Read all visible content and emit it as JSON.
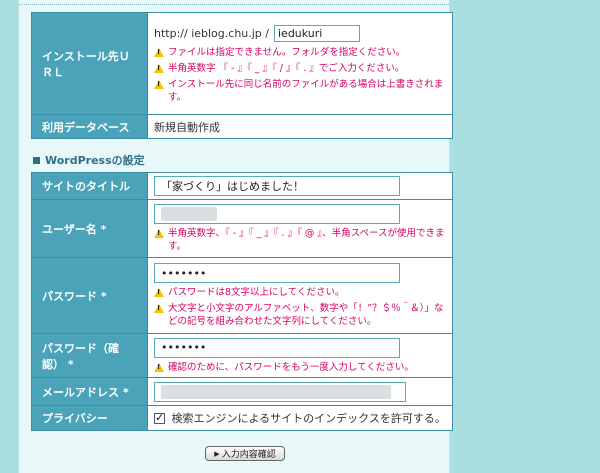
{
  "install": {
    "label": "インストール先ＵＲＬ",
    "url_prefix": "http:// ieblog.chu.jp /",
    "dir_value": "iedukuri",
    "warnings": [
      "ファイルは指定できません。フォルダを指定ください。",
      "半角英数字 『 - 』『 _ 』『 / 』『 . 』でご入力ください。",
      "インストール先に同じ名前のファイルがある場合は上書きされます。"
    ]
  },
  "database": {
    "label": "利用データベース",
    "value": "新規自動作成"
  },
  "wp_section": {
    "title": "WordPressの設定"
  },
  "site_title": {
    "label": "サイトのタイトル",
    "value": "「家づくり」はじめました！"
  },
  "username": {
    "label": "ユーザー名",
    "required_mark": "*",
    "warnings": [
      "半角英数字、『 - 』『 _ 』『 . 』『 @ 』、半角スペースが使用できます。"
    ]
  },
  "password": {
    "label": "パスワード",
    "required_mark": "*",
    "value": "•••••••",
    "warnings": [
      "パスワードは8文字以上にしてください。",
      "大文字と小文字のアルファベット、数字や「！”？＄％＾＆）」などの記号を組み合わせた文字列にしてください。"
    ]
  },
  "password_confirm": {
    "label": "パスワード（確認）",
    "required_mark": "*",
    "value": "•••••••",
    "warnings": [
      "確認のために、パスワードをもう一度入力してください。"
    ]
  },
  "email": {
    "label": "メールアドレス",
    "required_mark": "*"
  },
  "privacy": {
    "label": "プライバシー",
    "checkbox_label": "検索エンジンによるサイトのインデックスを許可する。",
    "checked": true
  },
  "submit": {
    "label": "入力内容確認"
  },
  "colors": {
    "background": "#a9dfe0",
    "label_cell": "#4aa3b9",
    "warning_text": "#d7005f",
    "section_title": "#2f6f8a"
  }
}
